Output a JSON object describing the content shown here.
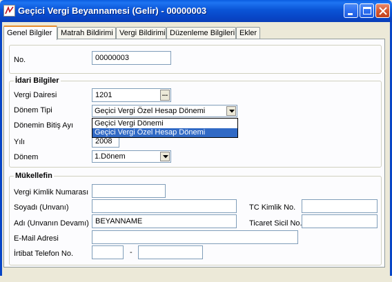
{
  "window": {
    "title": "Geçici Vergi Beyannamesi (Gelir) - 00000003"
  },
  "tabs": [
    {
      "label": "Genel Bilgiler"
    },
    {
      "label": "Matrah Bildirimi"
    },
    {
      "label": "Vergi Bildirimi"
    },
    {
      "label": "Düzenleme Bilgileri"
    },
    {
      "label": "Ekler"
    }
  ],
  "no": {
    "label": "No.",
    "value": "00000003"
  },
  "idari": {
    "title": "İdari Bilgiler",
    "vergi_dairesi": {
      "label": "Vergi Dairesi",
      "value": "1201",
      "button": "..."
    },
    "donem_tipi": {
      "label": "Dönem Tipi",
      "value": "Geçici Vergi Özel Hesap Dönemi",
      "options": [
        "Geçici Vergi Dönemi",
        "Geçici Vergi Özel Hesap Dönemi"
      ]
    },
    "donem_bitis": {
      "label": "Dönemin Bitiş Ayı"
    },
    "yil": {
      "label": "Yılı",
      "value": "2008"
    },
    "donem": {
      "label": "Dönem",
      "value": "1.Dönem"
    }
  },
  "mukellef": {
    "title": "Mükellefin",
    "vkn": {
      "label": "Vergi Kimlik Numarası",
      "value": ""
    },
    "soyadi": {
      "label": "Soyadı (Unvanı)",
      "value": ""
    },
    "tc": {
      "label": "TC Kimlik No.",
      "value": ""
    },
    "adi": {
      "label": "Adı (Unvanın Devamı)",
      "value": "BEYANNAME"
    },
    "ticaret": {
      "label": "Ticaret Sicil No.",
      "value": ""
    },
    "email": {
      "label": "E-Mail Adresi",
      "value": ""
    },
    "telefon": {
      "label": "İrtibat Telefon No.",
      "separator": "-",
      "area": "",
      "number": ""
    }
  },
  "icons": {
    "app": "app-logo-icon",
    "minimize": "minimize-icon",
    "maximize": "maximize-icon",
    "close": "close-icon",
    "combo": "chevron-down-icon"
  },
  "colors": {
    "titlebar": "#0a54d6",
    "selection": "#316ac5",
    "active_tab_accent": "#e68b2c",
    "close": "#d6582f"
  }
}
